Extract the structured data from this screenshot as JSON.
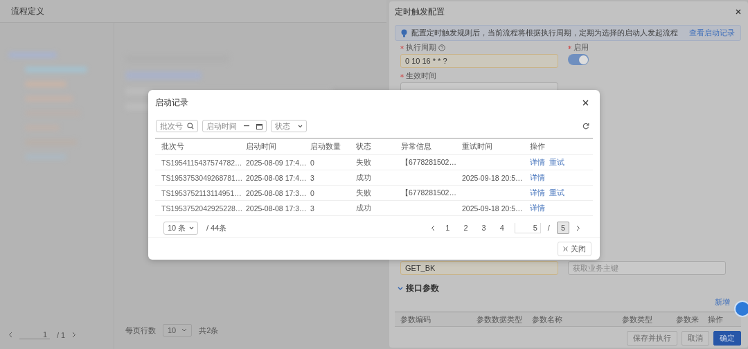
{
  "page": {
    "title": "流程定义",
    "pager": {
      "page": "1",
      "total": "/ 1"
    },
    "page_size_label": "每页行数",
    "page_size": "10",
    "total": "共2条"
  },
  "drawer": {
    "title": "定时触发配置",
    "info": "配置定时触发规则后，当前流程将根据执行周期，定期为选择的启动人发起流程",
    "info_link": "查看启动记录",
    "cron": {
      "label": "执行周期",
      "required": true,
      "value": "0 10 16 * * ?"
    },
    "enable": {
      "label": "启用",
      "required": true,
      "on": true
    },
    "effective": {
      "label": "生效时间",
      "required": true
    },
    "key_value": "GET_BK",
    "key_placeholder": "获取业务主键",
    "section": {
      "title": "接口参数",
      "expanded": true
    },
    "add_button": "新增",
    "param_columns": [
      "参数编码",
      "参数数据类型",
      "参数名称",
      "参数类型",
      "参数来",
      "操作"
    ],
    "buttons": [
      {
        "label": "保存并执行",
        "kind": "default"
      },
      {
        "label": "取消",
        "kind": "cancel"
      },
      {
        "label": "确定",
        "kind": "primary"
      }
    ]
  },
  "modal": {
    "title": "启动记录",
    "filters": {
      "batch_placeholder": "批次号",
      "time_placeholder": "启动时间",
      "status_placeholder": "状态"
    },
    "columns": [
      "批次号",
      "启动时间",
      "启动数量",
      "状态",
      "异常信息",
      "重试时间",
      "操作"
    ],
    "rows": [
      {
        "batch": "TS1954115437574782…",
        "time": "2025-08-09 17:4…",
        "count": "0",
        "status": "失败",
        "error": "【6778281502…",
        "actions": [
          "详情",
          "重试"
        ]
      },
      {
        "batch": "TS1953753049268781…",
        "time": "2025-08-08 17:4…",
        "count": "3",
        "status": "成功",
        "retry_time": "2025-09-18 20:5…",
        "actions": [
          "详情"
        ]
      },
      {
        "batch": "TS1953752113114951…",
        "time": "2025-08-08 17:3…",
        "count": "0",
        "status": "失败",
        "error": "【6778281502…",
        "actions": [
          "详情",
          "重试"
        ]
      },
      {
        "batch": "TS1953752042925228…",
        "time": "2025-08-08 17:3…",
        "count": "3",
        "status": "成功",
        "retry_time": "2025-09-18 20:5…",
        "actions": [
          "详情"
        ]
      }
    ],
    "pagination": {
      "page_size": "10 条",
      "total": "/ 44条",
      "pages": [
        {
          "label": "1",
          "selected": false
        },
        {
          "label": "2",
          "selected": false
        },
        {
          "label": "3",
          "selected": false
        },
        {
          "label": "4",
          "selected": false
        }
      ],
      "jump_value": "5",
      "separator": "/",
      "last_page": {
        "label": "5",
        "selected": true
      }
    },
    "close_button": "关闭"
  }
}
